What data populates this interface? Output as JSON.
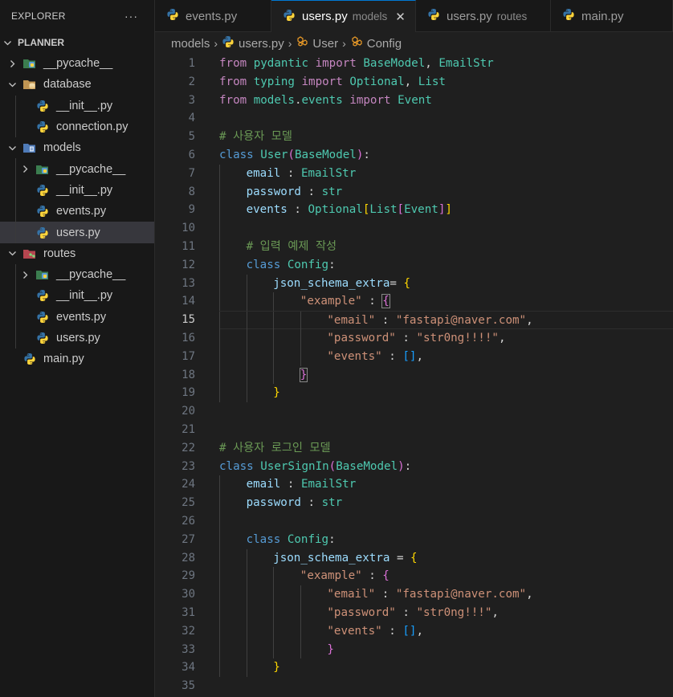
{
  "sidebar": {
    "title": "EXPLORER",
    "more_icon": "ellipsis-icon",
    "root": "PLANNER",
    "tree": [
      {
        "label": "__pycache__",
        "depth": 0,
        "chevron": "right",
        "icon": "pycache-folder-icon"
      },
      {
        "label": "database",
        "depth": 0,
        "chevron": "down",
        "icon": "database-folder-icon"
      },
      {
        "label": "__init__.py",
        "depth": 1,
        "chevron": "none",
        "icon": "python-icon"
      },
      {
        "label": "connection.py",
        "depth": 1,
        "chevron": "none",
        "icon": "python-icon"
      },
      {
        "label": "models",
        "depth": 0,
        "chevron": "down",
        "icon": "models-folder-icon"
      },
      {
        "label": "__pycache__",
        "depth": 1,
        "chevron": "right",
        "icon": "pycache-folder-icon"
      },
      {
        "label": "__init__.py",
        "depth": 1,
        "chevron": "none",
        "icon": "python-icon"
      },
      {
        "label": "events.py",
        "depth": 1,
        "chevron": "none",
        "icon": "python-icon"
      },
      {
        "label": "users.py",
        "depth": 1,
        "chevron": "none",
        "icon": "python-icon",
        "selected": true
      },
      {
        "label": "routes",
        "depth": 0,
        "chevron": "down",
        "icon": "routes-folder-icon"
      },
      {
        "label": "__pycache__",
        "depth": 1,
        "chevron": "right",
        "icon": "pycache-folder-icon"
      },
      {
        "label": "__init__.py",
        "depth": 1,
        "chevron": "none",
        "icon": "python-icon"
      },
      {
        "label": "events.py",
        "depth": 1,
        "chevron": "none",
        "icon": "python-icon"
      },
      {
        "label": "users.py",
        "depth": 1,
        "chevron": "none",
        "icon": "python-icon"
      },
      {
        "label": "main.py",
        "depth": 0,
        "chevron": "none",
        "icon": "python-icon"
      }
    ]
  },
  "tabs": [
    {
      "label": "events.py",
      "desc": "",
      "active": false,
      "close": false,
      "width": 145
    },
    {
      "label": "users.py",
      "desc": "models",
      "active": true,
      "close": true,
      "width": 180
    },
    {
      "label": "users.py",
      "desc": "routes",
      "active": false,
      "close": false,
      "width": 168
    },
    {
      "label": "main.py",
      "desc": "",
      "active": false,
      "close": false,
      "width": 152
    }
  ],
  "breadcrumb": {
    "folder": "models",
    "file": "users.py",
    "cls": "User",
    "member": "Config"
  },
  "editor": {
    "current_line": 15,
    "lines": [
      {
        "n": "1",
        "i": 0,
        "t": [
          [
            "from ",
            "kw"
          ],
          [
            "pydantic ",
            "cls"
          ],
          [
            "import ",
            "kw"
          ],
          [
            "BaseModel",
            "cls"
          ],
          [
            ", ",
            "op"
          ],
          [
            "EmailStr",
            "cls"
          ]
        ]
      },
      {
        "n": "2",
        "i": 0,
        "t": [
          [
            "from ",
            "kw"
          ],
          [
            "typing ",
            "cls"
          ],
          [
            "import ",
            "kw"
          ],
          [
            "Optional",
            "cls"
          ],
          [
            ", ",
            "op"
          ],
          [
            "List",
            "cls"
          ]
        ]
      },
      {
        "n": "3",
        "i": 0,
        "t": [
          [
            "from ",
            "kw"
          ],
          [
            "models",
            "cls"
          ],
          [
            ".",
            "op"
          ],
          [
            "events ",
            "cls"
          ],
          [
            "import ",
            "kw"
          ],
          [
            "Event",
            "cls"
          ]
        ]
      },
      {
        "n": "4",
        "i": 0,
        "t": []
      },
      {
        "n": "5",
        "i": 0,
        "t": [
          [
            "# 사용자 모델",
            "cmt"
          ]
        ]
      },
      {
        "n": "6",
        "i": 0,
        "t": [
          [
            "class ",
            "kw2"
          ],
          [
            "User",
            "cls"
          ],
          [
            "(",
            "b2"
          ],
          [
            "BaseModel",
            "cls"
          ],
          [
            ")",
            "b2"
          ],
          [
            ":",
            "op"
          ]
        ]
      },
      {
        "n": "7",
        "i": 1,
        "t": [
          [
            "email ",
            "var"
          ],
          [
            ": ",
            "op"
          ],
          [
            "EmailStr",
            "cls"
          ]
        ]
      },
      {
        "n": "8",
        "i": 1,
        "t": [
          [
            "password ",
            "var"
          ],
          [
            ": ",
            "op"
          ],
          [
            "str",
            "cls"
          ]
        ]
      },
      {
        "n": "9",
        "i": 1,
        "t": [
          [
            "events ",
            "var"
          ],
          [
            ": ",
            "op"
          ],
          [
            "Optional",
            "cls"
          ],
          [
            "[",
            "b1"
          ],
          [
            "List",
            "cls"
          ],
          [
            "[",
            "b2"
          ],
          [
            "Event",
            "cls"
          ],
          [
            "]",
            "b2"
          ],
          [
            "]",
            "b1"
          ]
        ]
      },
      {
        "n": "10",
        "i": 0,
        "t": []
      },
      {
        "n": "11",
        "i": 1,
        "t": [
          [
            "# 입력 예제 작성",
            "cmt"
          ]
        ]
      },
      {
        "n": "12",
        "i": 1,
        "t": [
          [
            "class ",
            "kw2"
          ],
          [
            "Config",
            "cls"
          ],
          [
            ":",
            "op"
          ]
        ]
      },
      {
        "n": "13",
        "i": 2,
        "t": [
          [
            "json_schema_extra",
            "var"
          ],
          [
            "= ",
            "op"
          ],
          [
            "{",
            "b1"
          ]
        ]
      },
      {
        "n": "14",
        "i": 3,
        "t": [
          [
            "\"example\"",
            "str"
          ],
          [
            " : ",
            "op"
          ],
          [
            "{",
            "b2m"
          ]
        ]
      },
      {
        "n": "15",
        "i": 4,
        "t": [
          [
            "\"email\"",
            "str"
          ],
          [
            " : ",
            "op"
          ],
          [
            "\"fastapi@naver.com\"",
            "str"
          ],
          [
            ",",
            "op"
          ]
        ]
      },
      {
        "n": "16",
        "i": 4,
        "t": [
          [
            "\"password\"",
            "str"
          ],
          [
            " : ",
            "op"
          ],
          [
            "\"str0ng!!!!\"",
            "str"
          ],
          [
            ",",
            "op"
          ]
        ]
      },
      {
        "n": "17",
        "i": 4,
        "t": [
          [
            "\"events\"",
            "str"
          ],
          [
            " : ",
            "op"
          ],
          [
            "[]",
            "b3"
          ],
          [
            ",",
            "op"
          ]
        ]
      },
      {
        "n": "18",
        "i": 3,
        "t": [
          [
            "}",
            "b2m"
          ]
        ]
      },
      {
        "n": "19",
        "i": 2,
        "t": [
          [
            "}",
            "b1"
          ]
        ]
      },
      {
        "n": "20",
        "i": 0,
        "t": []
      },
      {
        "n": "21",
        "i": 0,
        "t": []
      },
      {
        "n": "22",
        "i": 0,
        "t": [
          [
            "# 사용자 로그인 모델",
            "cmt"
          ]
        ]
      },
      {
        "n": "23",
        "i": 0,
        "t": [
          [
            "class ",
            "kw2"
          ],
          [
            "UserSignIn",
            "cls"
          ],
          [
            "(",
            "b2"
          ],
          [
            "BaseModel",
            "cls"
          ],
          [
            ")",
            "b2"
          ],
          [
            ":",
            "op"
          ]
        ]
      },
      {
        "n": "24",
        "i": 1,
        "t": [
          [
            "email ",
            "var"
          ],
          [
            ": ",
            "op"
          ],
          [
            "EmailStr",
            "cls"
          ]
        ]
      },
      {
        "n": "25",
        "i": 1,
        "t": [
          [
            "password ",
            "var"
          ],
          [
            ": ",
            "op"
          ],
          [
            "str",
            "cls"
          ]
        ]
      },
      {
        "n": "26",
        "i": 0,
        "t": []
      },
      {
        "n": "27",
        "i": 1,
        "t": [
          [
            "class ",
            "kw2"
          ],
          [
            "Config",
            "cls"
          ],
          [
            ":",
            "op"
          ]
        ]
      },
      {
        "n": "28",
        "i": 2,
        "t": [
          [
            "json_schema_extra ",
            "var"
          ],
          [
            "= ",
            "op"
          ],
          [
            "{",
            "b1"
          ]
        ]
      },
      {
        "n": "29",
        "i": 3,
        "t": [
          [
            "\"example\"",
            "str"
          ],
          [
            " : ",
            "op"
          ],
          [
            "{",
            "b2"
          ]
        ]
      },
      {
        "n": "30",
        "i": 4,
        "t": [
          [
            "\"email\"",
            "str"
          ],
          [
            " : ",
            "op"
          ],
          [
            "\"fastapi@naver.com\"",
            "str"
          ],
          [
            ",",
            "op"
          ]
        ]
      },
      {
        "n": "31",
        "i": 4,
        "t": [
          [
            "\"password\"",
            "str"
          ],
          [
            " : ",
            "op"
          ],
          [
            "\"str0ng!!!\"",
            "str"
          ],
          [
            ",",
            "op"
          ]
        ]
      },
      {
        "n": "32",
        "i": 4,
        "t": [
          [
            "\"events\"",
            "str"
          ],
          [
            " : ",
            "op"
          ],
          [
            "[]",
            "b3"
          ],
          [
            ",",
            "op"
          ]
        ]
      },
      {
        "n": "33",
        "i": 4,
        "t": [
          [
            "}",
            "b2"
          ]
        ]
      },
      {
        "n": "34",
        "i": 2,
        "t": [
          [
            "}",
            "b1"
          ]
        ]
      },
      {
        "n": "35",
        "i": 0,
        "t": []
      }
    ]
  },
  "colors": {
    "accent": "#0078d4",
    "python_blue": "#3572a5",
    "python_yellow": "#ffd43b"
  }
}
